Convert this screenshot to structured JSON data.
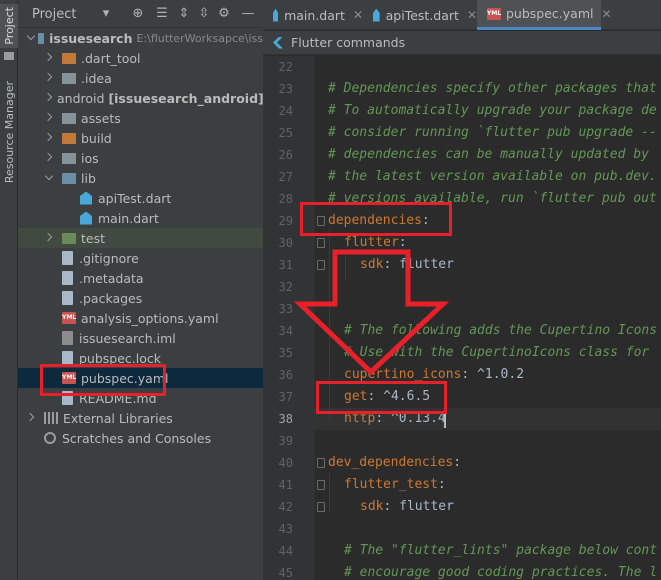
{
  "sidebar_strip": {
    "project_tab": "Project",
    "resource_tab": "Resource Manager"
  },
  "project_panel": {
    "title": "Project",
    "root": {
      "name": "issuesearch",
      "path": "E:\\flutterWorksapce\\iss"
    },
    "items": [
      {
        "label": ".dart_tool",
        "type": "folder-orange",
        "expand": "collapsed"
      },
      {
        "label": ".idea",
        "type": "folder",
        "expand": "collapsed"
      },
      {
        "label": "android",
        "extra": "[issuesearch_android]",
        "type": "folder",
        "expand": "collapsed"
      },
      {
        "label": "assets",
        "type": "folder",
        "expand": "collapsed"
      },
      {
        "label": "build",
        "type": "folder-orange",
        "expand": "collapsed"
      },
      {
        "label": "ios",
        "type": "folder",
        "expand": "collapsed"
      },
      {
        "label": "lib",
        "type": "folder-blue",
        "expand": "expanded"
      },
      {
        "label": "apiTest.dart",
        "type": "dart"
      },
      {
        "label": "main.dart",
        "type": "dart"
      },
      {
        "label": "test",
        "type": "folder-green",
        "expand": "collapsed"
      },
      {
        "label": ".gitignore",
        "type": "file"
      },
      {
        "label": ".metadata",
        "type": "file"
      },
      {
        "label": ".packages",
        "type": "file"
      },
      {
        "label": "analysis_options.yaml",
        "type": "yaml"
      },
      {
        "label": "issuesearch.iml",
        "type": "iml"
      },
      {
        "label": "pubspec.lock",
        "type": "file"
      },
      {
        "label": "pubspec.yaml",
        "type": "yaml"
      },
      {
        "label": "README.md",
        "type": "file"
      },
      {
        "label": "External Libraries",
        "type": "lib",
        "expand": "collapsed"
      },
      {
        "label": "Scratches and Consoles",
        "type": "scratch"
      }
    ]
  },
  "tabs": [
    {
      "label": "main.dart",
      "icon": "dart-icon",
      "active": false
    },
    {
      "label": "apiTest.dart",
      "icon": "dart-icon",
      "active": false
    },
    {
      "label": "pubspec.yaml",
      "icon": "yaml-icon",
      "active": true
    }
  ],
  "notice": {
    "text": "Flutter commands"
  },
  "editor": {
    "current_line": "38",
    "lines": [
      {
        "n": "22",
        "text": ""
      },
      {
        "n": "23",
        "text": "# Dependencies specify other packages that"
      },
      {
        "n": "24",
        "text": "# To automatically upgrade your package de"
      },
      {
        "n": "25",
        "text": "# consider running `flutter pub upgrade --"
      },
      {
        "n": "26",
        "text": "# dependencies can be manually updated by"
      },
      {
        "n": "27",
        "text": "# the latest version available on pub.dev."
      },
      {
        "n": "28",
        "text": "# versions available, run `flutter pub out"
      },
      {
        "n": "29",
        "key": "dependencies",
        "value": ""
      },
      {
        "n": "30",
        "key": "flutter",
        "value": ""
      },
      {
        "n": "31",
        "key": "sdk",
        "value": " flutter"
      },
      {
        "n": "32",
        "text": ""
      },
      {
        "n": "33",
        "text": ""
      },
      {
        "n": "34",
        "text": "# The following adds the Cupertino Icons"
      },
      {
        "n": "35",
        "text": "# Use with the CupertinoIcons class for"
      },
      {
        "n": "36",
        "key": "cupertino_icons",
        "value": " ^1.0.2"
      },
      {
        "n": "37",
        "key": "get",
        "value": " ^4.6.5"
      },
      {
        "n": "38",
        "key": "http",
        "value": " ^0.13.4"
      },
      {
        "n": "39",
        "text": ""
      },
      {
        "n": "40",
        "key": "dev_dependencies",
        "value": ""
      },
      {
        "n": "41",
        "key": "flutter_test",
        "value": ""
      },
      {
        "n": "42",
        "key": "sdk",
        "value": " flutter"
      },
      {
        "n": "43",
        "text": ""
      },
      {
        "n": "44",
        "text": "# The \"flutter_lints\" package below cont"
      },
      {
        "n": "45",
        "text": "# encourage good coding practices. The l"
      }
    ]
  },
  "colors": {
    "annotation_red": "#e8202a",
    "comment_green": "#629755",
    "key_orange": "#cc7832"
  }
}
